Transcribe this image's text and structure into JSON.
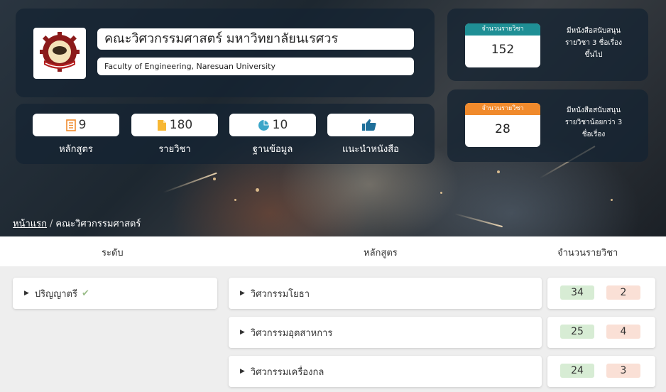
{
  "faculty": {
    "name_th": "คณะวิศวกรรมศาสตร์ มหาวิทยาลัยนเรศวร",
    "name_en": "Faculty of Engineering, Naresuan University"
  },
  "stats": [
    {
      "value": "9",
      "label": "หลักสูตร",
      "icon": "document-list-icon"
    },
    {
      "value": "180",
      "label": "รายวิชา",
      "icon": "file-icon"
    },
    {
      "value": "10",
      "label": "ฐานข้อมูล",
      "icon": "pie-chart-icon"
    },
    {
      "value": "",
      "label": "แนะนำหนังสือ",
      "icon": "thumbs-up-icon"
    }
  ],
  "counts": [
    {
      "header": "จำนวนรายวิชา",
      "value": "152",
      "description_lines": [
        "มีหนังสือสนับสนุน",
        "รายวิชา 3 ชื่อเรื่อง",
        "ขึ้นไป"
      ],
      "color": "#1f8f95"
    },
    {
      "header": "จำนวนรายวิชา",
      "value": "28",
      "description_lines": [
        "มีหนังสือสนับสนุน",
        "รายวิชาน้อยกว่า 3",
        "ชื่อเรื่อง"
      ],
      "color": "#f08a2c"
    }
  ],
  "breadcrumb": {
    "home": "หน้าแรก",
    "separator": "/",
    "current": "คณะวิศวกรรมศาสตร์"
  },
  "table": {
    "headers": {
      "level": "ระดับ",
      "program": "หลักสูตร",
      "count": "จำนวนรายวิชา"
    },
    "level": {
      "label": "ปริญญาตรี",
      "checked": true
    },
    "rows": [
      {
        "program": "วิศวกรรมโยธา",
        "green": "34",
        "orange": "2"
      },
      {
        "program": "วิศวกรรมอุตสาหการ",
        "green": "25",
        "orange": "4"
      },
      {
        "program": "วิศวกรรมเครื่องกล",
        "green": "24",
        "orange": "3"
      }
    ]
  },
  "colors": {
    "teal": "#1f8f95",
    "orange": "#f08a2c",
    "pill_green": "#d7ecd4",
    "pill_orange": "#fae0d6"
  }
}
